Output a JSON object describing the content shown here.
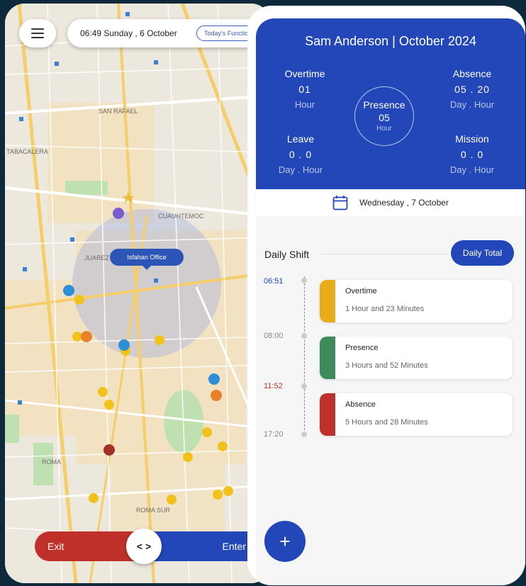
{
  "map": {
    "datetime": "06:49 Sunday , 6 October",
    "function_button": "Today's Function",
    "office_label": "Isfahan Office",
    "labels": {
      "san_rafael": "SAN RAFAEL",
      "tabacalera": "TABACALERA",
      "cuauhtemoc": "CUAUHTEMOC",
      "juarez": "JUAREZ",
      "roma": "ROMA",
      "roma_sur": "ROMA SUR"
    },
    "exit_label": "Exit",
    "enter_label": "Enter",
    "toggle_label": "< >",
    "colors": {
      "exit": "#c0302a",
      "enter": "#2346b8"
    }
  },
  "header": {
    "title": "Sam Anderson | October 2024",
    "overtime": {
      "label": "Overtime",
      "value": "01",
      "unit": "Hour"
    },
    "absence": {
      "label": "Absence",
      "value": "05 . 20",
      "unit": "Day .  Hour"
    },
    "presence": {
      "label": "Presence",
      "value": "05",
      "unit": "Hour"
    },
    "leave": {
      "label": "Leave",
      "value": "0 . 0",
      "unit": "Day .  Hour"
    },
    "mission": {
      "label": "Mission",
      "value": "0 . 0",
      "unit": "Day .  Hour"
    }
  },
  "date_row": {
    "icon": "calendar-icon",
    "label": "Wednesday , 7 October"
  },
  "shift": {
    "title": "Daily Shift",
    "daily_total_label": "Daily Total",
    "times": [
      "06:51",
      "08:00",
      "11:52",
      "17:20"
    ],
    "cards": [
      {
        "name": "Overtime",
        "duration": "1 Hour and 23 Minutes",
        "color": "#e8ae1a"
      },
      {
        "name": "Presence",
        "duration": "3 Hours and 52 Minutes",
        "color": "#3f8a5a"
      },
      {
        "name": "Absence",
        "duration": "5 Hours and 28 Minutes",
        "color": "#c0302a"
      }
    ],
    "fab_label": "+"
  },
  "colors": {
    "primary": "#2346b8"
  }
}
